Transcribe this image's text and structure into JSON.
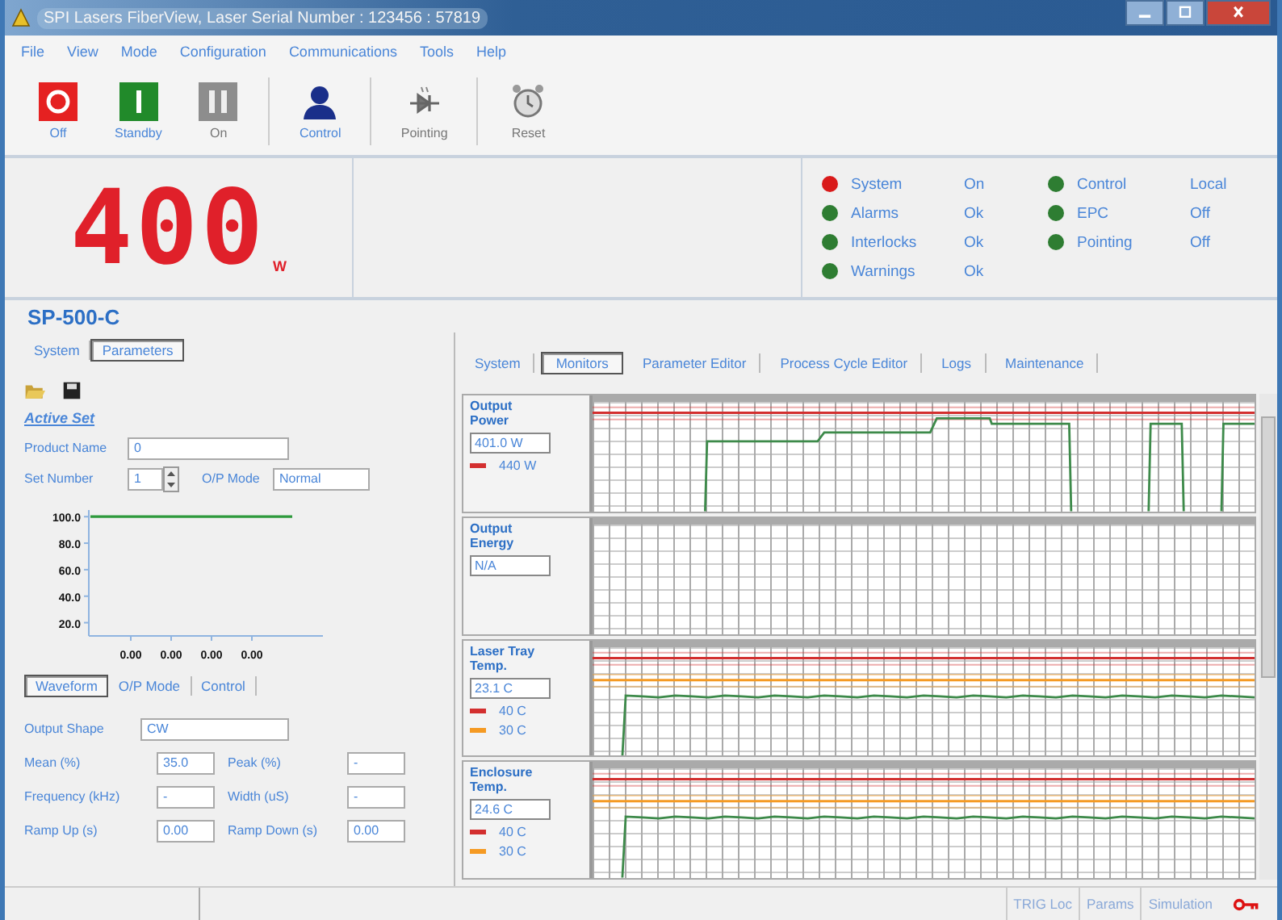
{
  "window": {
    "title": "SPI Lasers FiberView, Laser Serial Number : 123456 : 57819"
  },
  "menu": [
    "File",
    "View",
    "Mode",
    "Configuration",
    "Communications",
    "Tools",
    "Help"
  ],
  "toolbar": [
    {
      "label": "Off",
      "kind": "off",
      "disabled": false
    },
    {
      "label": "Standby",
      "kind": "standby",
      "disabled": false
    },
    {
      "label": "On",
      "kind": "on",
      "disabled": true
    },
    {
      "label": "Control",
      "kind": "control",
      "disabled": false
    },
    {
      "label": "Pointing",
      "kind": "pointing",
      "disabled": true
    },
    {
      "label": "Reset",
      "kind": "reset",
      "disabled": true
    }
  ],
  "power_display": {
    "value": "400",
    "unit": "W"
  },
  "status": [
    {
      "label": "System",
      "value": "On",
      "color": "#d91a1a"
    },
    {
      "label": "Alarms",
      "value": "Ok",
      "color": "#2e7d32"
    },
    {
      "label": "Interlocks",
      "value": "Ok",
      "color": "#2e7d32"
    },
    {
      "label": "Warnings",
      "value": "Ok",
      "color": "#2e7d32"
    },
    {
      "label": "Control",
      "value": "Local",
      "color": "#2e7d32"
    },
    {
      "label": "EPC",
      "value": "Off",
      "color": "#2e7d32"
    },
    {
      "label": "Pointing",
      "value": "Off",
      "color": "#2e7d32"
    }
  ],
  "model": "SP-500-C",
  "left_tabs": [
    {
      "label": "System",
      "selected": false
    },
    {
      "label": "Parameters",
      "selected": true
    }
  ],
  "active_set": {
    "title": "Active Set",
    "product_name_label": "Product Name",
    "product_name": "0",
    "set_number_label": "Set Number",
    "set_number": "1",
    "op_mode_label": "O/P Mode",
    "op_mode": "Normal"
  },
  "waveform_chart": {
    "chart_data": {
      "type": "line",
      "categories": [
        null,
        "0.00",
        "0.00",
        "0.00",
        "0.00",
        null
      ],
      "ylim": [
        10,
        105
      ],
      "yticks": [
        {
          "value": 100,
          "label": "100.0"
        },
        {
          "value": 80,
          "label": "80.0"
        },
        {
          "value": 60,
          "label": "60.0"
        },
        {
          "value": 40,
          "label": "40.0"
        },
        {
          "value": 20,
          "label": "20.0"
        }
      ],
      "series": [
        {
          "color": "#2e9a3c",
          "values": [
            100,
            100,
            100,
            100,
            100,
            100
          ]
        }
      ]
    }
  },
  "waveform_tabs": [
    {
      "label": "Waveform",
      "selected": true
    },
    {
      "label": "O/P Mode",
      "selected": false
    },
    {
      "label": "Control",
      "selected": false
    }
  ],
  "waveform_fields": {
    "output_shape_label": "Output Shape",
    "output_shape": "CW",
    "rows": [
      {
        "left_label": "Mean (%)",
        "left_value": "35.0",
        "right_label": "Peak (%)",
        "right_value": "-"
      },
      {
        "left_label": "Frequency (kHz)",
        "left_value": "-",
        "right_label": "Width (uS)",
        "right_value": "-"
      },
      {
        "left_label": "Ramp Up (s)",
        "left_value": "0.00",
        "right_label": "Ramp Down (s)",
        "right_value": "0.00"
      }
    ]
  },
  "right_tabs": [
    {
      "label": "System",
      "selected": false
    },
    {
      "label": "Monitors",
      "selected": true
    },
    {
      "label": "Parameter Editor",
      "selected": false
    },
    {
      "label": "Process Cycle Editor",
      "selected": false
    },
    {
      "label": "Logs",
      "selected": false
    },
    {
      "label": "Maintenance",
      "selected": false
    }
  ],
  "monitors": [
    {
      "title": "Output Power",
      "value": "401.0 W",
      "kind": "steps",
      "limits": [
        {
          "label": "440 W",
          "color": "#d32f2f"
        }
      ]
    },
    {
      "title": "Output Energy",
      "value": "N/A",
      "kind": "empty"
    },
    {
      "title": "Laser Tray Temp.",
      "value": "23.1 C",
      "kind": "steady",
      "limits": [
        {
          "label": "40 C",
          "color": "#d32f2f"
        },
        {
          "label": "30 C",
          "color": "#f59a23"
        }
      ]
    },
    {
      "title": "Enclosure Temp.",
      "value": "24.6 C",
      "kind": "steady",
      "limits": [
        {
          "label": "40 C",
          "color": "#d32f2f"
        },
        {
          "label": "30 C",
          "color": "#f59a23"
        }
      ]
    }
  ],
  "status_bar": [
    "TRIG Loc",
    "Params",
    "Simulation"
  ]
}
